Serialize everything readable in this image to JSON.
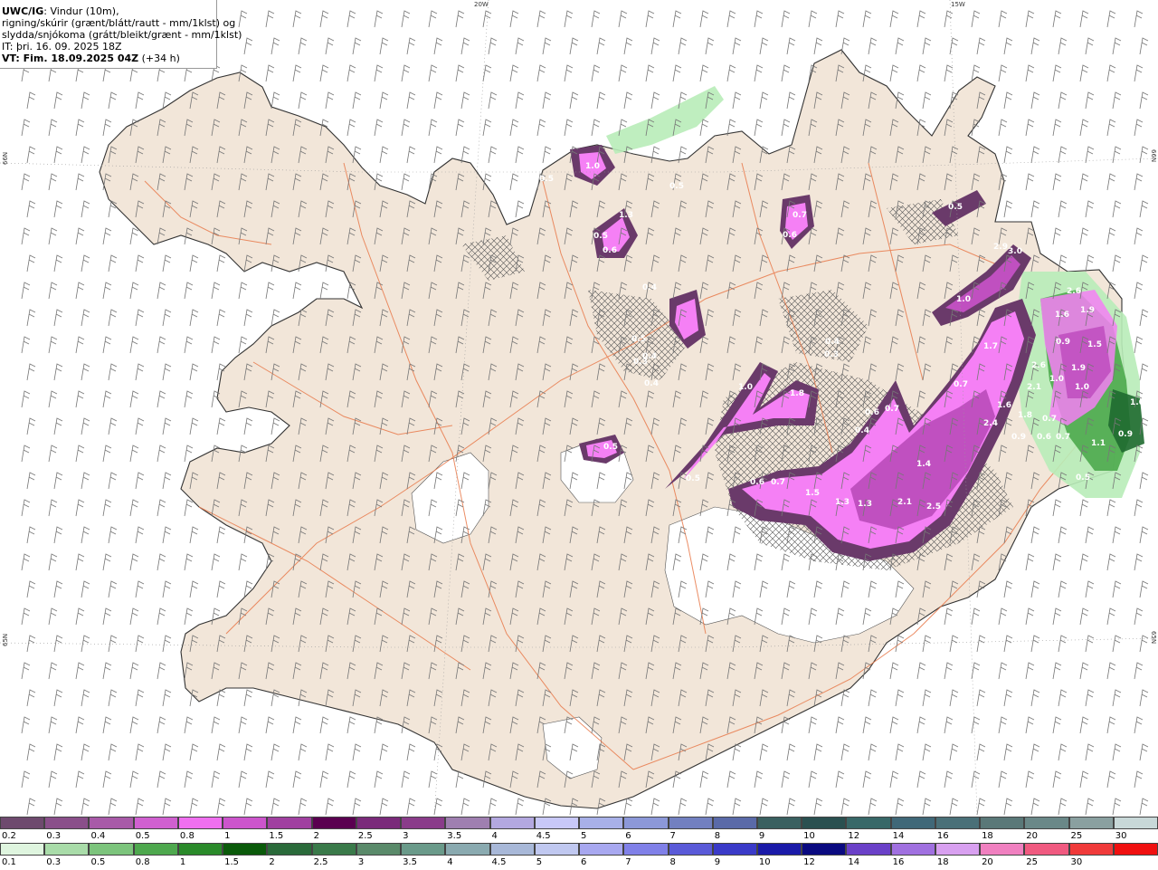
{
  "header": {
    "model": "UWC/IG",
    "line1_rest": ": Vindur (10m),",
    "line2": "rigning/skúrir (grænt/blátt/rautt - mm/1klst) og",
    "line3": "slydda/snjókoma (grátt/bleikt/grænt - mm/1klst)",
    "line4": "IT: þri. 16. 09. 2025 18Z",
    "line5_bold": "VT: Fim. 18.09.2025 04Z",
    "line5_rest": "(+34 h)"
  },
  "grid_labels": {
    "lon20": "20W",
    "lon15": "15W",
    "lat66_left": "66N",
    "lat66_right": "66N",
    "lat65_left": "65N",
    "lat65_right": "65N"
  },
  "colors": {
    "land": "#f2e6d9",
    "glacier": "#ffffff",
    "roads": "#e8794a",
    "coast": "#333333",
    "snow_light": "#f580f5",
    "snow_mid": "#c050c0",
    "snow_dark": "#6a3a6a",
    "rain_light": "#b8ecb8",
    "rain_mid": "#4caa4c",
    "rain_dark": "#1f6a30"
  },
  "precip_values": [
    {
      "label": "1.0"
    },
    {
      "label": "0.5"
    },
    {
      "label": "0.5"
    },
    {
      "label": "0.6"
    },
    {
      "label": "1.3"
    },
    {
      "label": "0.4"
    },
    {
      "label": "0.5"
    },
    {
      "label": "0.4"
    },
    {
      "label": "0.7"
    },
    {
      "label": "0.6"
    },
    {
      "label": "0.5"
    },
    {
      "label": "2.9"
    },
    {
      "label": "3.0"
    },
    {
      "label": "1.0"
    },
    {
      "label": "2.6"
    },
    {
      "label": "1.6"
    },
    {
      "label": "1.9"
    },
    {
      "label": "0.9"
    },
    {
      "label": "0.5"
    },
    {
      "label": "0.3"
    },
    {
      "label": "0.4"
    },
    {
      "label": "1.0"
    },
    {
      "label": "1.8"
    },
    {
      "label": "0.3"
    },
    {
      "label": "1.7"
    },
    {
      "label": "1.5"
    },
    {
      "label": "1.9"
    },
    {
      "label": "2.6"
    },
    {
      "label": "0.7"
    },
    {
      "label": "0.5"
    },
    {
      "label": "0.6"
    },
    {
      "label": "0.7"
    },
    {
      "label": "0.4"
    },
    {
      "label": "2.1"
    },
    {
      "label": "1.0"
    },
    {
      "label": "1.6"
    },
    {
      "label": "2.4"
    },
    {
      "label": "1.8"
    },
    {
      "label": "0.7"
    },
    {
      "label": "1.0"
    },
    {
      "label": "0.9"
    },
    {
      "label": "0.6"
    },
    {
      "label": "0.7"
    },
    {
      "label": "1.1"
    },
    {
      "label": "0.9"
    },
    {
      "label": "1.0"
    },
    {
      "label": "1.4"
    },
    {
      "label": "0.6"
    },
    {
      "label": "0.7"
    },
    {
      "label": "1.5"
    },
    {
      "label": "1.3"
    },
    {
      "label": "1.3"
    },
    {
      "label": "2.1"
    },
    {
      "label": "2.5"
    },
    {
      "label": "0.5"
    },
    {
      "label": "0.4"
    },
    {
      "label": "0.5"
    }
  ],
  "legend": {
    "snow": {
      "ticks": [
        "0.2",
        "0.3",
        "0.4",
        "0.5",
        "0.8",
        "1",
        "1.5",
        "2",
        "2.5",
        "3",
        "3.5",
        "4",
        "4.5",
        "5",
        "6",
        "7",
        "8",
        "9",
        "10",
        "12",
        "14",
        "16",
        "18",
        "20",
        "25",
        "30"
      ],
      "colors": [
        "#6e4a6e",
        "#8a4f8a",
        "#a85aa8",
        "#d060d0",
        "#f06ff0",
        "#cc55cc",
        "#a040a0",
        "#5a0050",
        "#7a2a7a",
        "#8a3c8a",
        "#9f7fb0",
        "#b3a8e0",
        "#c8c8f8",
        "#a8b0e8",
        "#8c98d8",
        "#7280c0",
        "#5a6aa8",
        "#3a6060",
        "#2a5050",
        "#386868",
        "#406878",
        "#4a7078",
        "#5a7878",
        "#6a8888",
        "#8aa0a0",
        "#c8d8d8"
      ]
    },
    "rain": {
      "ticks": [
        "0.1",
        "0.3",
        "0.5",
        "0.8",
        "1",
        "1.5",
        "2",
        "2.5",
        "3",
        "3.5",
        "4",
        "4.5",
        "5",
        "6",
        "7",
        "8",
        "9",
        "10",
        "12",
        "14",
        "16",
        "18",
        "20",
        "25",
        "30"
      ],
      "colors": [
        "#dff5df",
        "#a9dca9",
        "#7cc47c",
        "#4ea84e",
        "#2a8a2a",
        "#0a5a0a",
        "#2a6a3a",
        "#3a7a4a",
        "#5a8a6a",
        "#6a9a8a",
        "#8aaab0",
        "#a8b8d8",
        "#c0c8f0",
        "#a8a8f0",
        "#8080e8",
        "#5a5ad8",
        "#3a3ac8",
        "#1a1aa8",
        "#0a0a80",
        "#6a40c8",
        "#a070e0",
        "#d8a0f0",
        "#f080c0",
        "#f05a80",
        "#f03a3a",
        "#f01010"
      ]
    }
  }
}
